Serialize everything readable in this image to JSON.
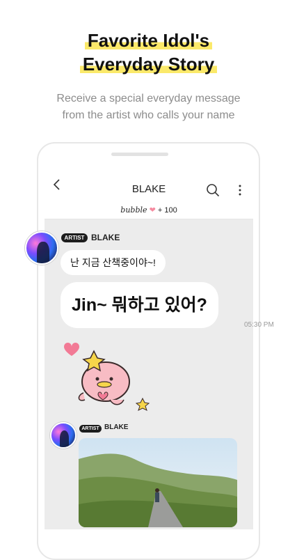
{
  "headline": {
    "line1": "Favorite Idol's",
    "line2": "Everyday Story"
  },
  "subtitle": {
    "line1": "Receive a special everyday message",
    "line2": "from the artist who calls your name"
  },
  "chat": {
    "title": "BLAKE",
    "bubble_brand": "bubble",
    "bubble_count": "+ 100",
    "sender1": {
      "badge": "ARTIST",
      "name": "BLAKE"
    },
    "message1": "난 지금 산책중이야~!",
    "message2": "Jin~ 뭐하고 있어?",
    "time": "05:30 PM",
    "sender2": {
      "badge": "ARTIST",
      "name": "BLAKE"
    }
  },
  "colors": {
    "highlight": "#fbe96a",
    "heart": "#f27a95",
    "screen_bg": "#ececec"
  }
}
